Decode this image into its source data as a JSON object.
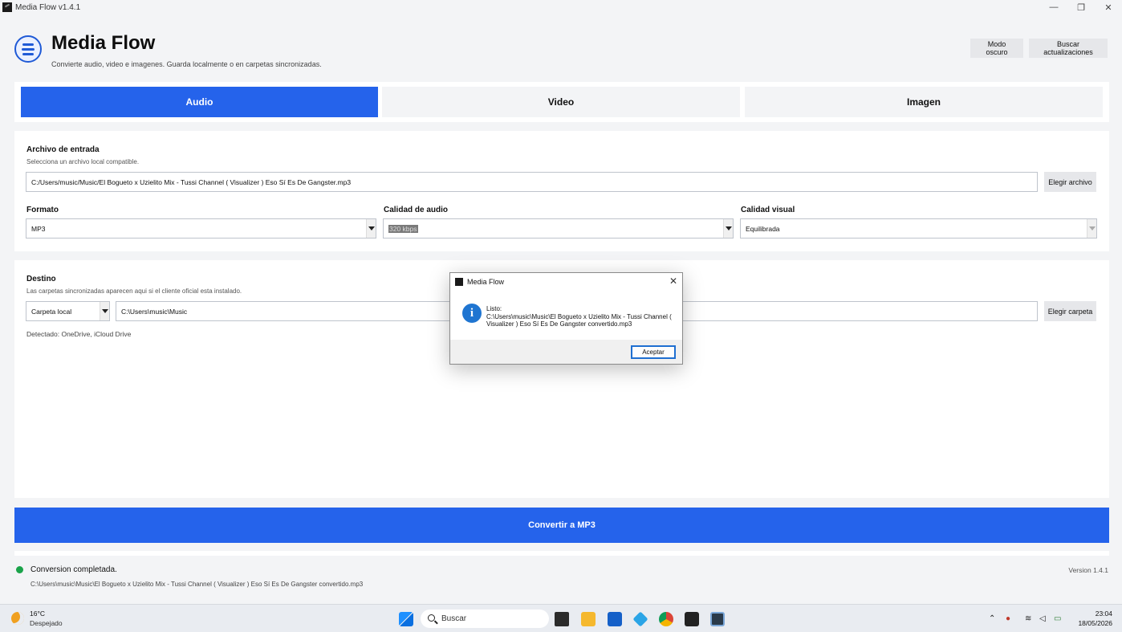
{
  "window": {
    "title": "Media Flow v1.4.1",
    "controls": {
      "minimize": "—",
      "maximize": "❐",
      "close": "✕"
    }
  },
  "header": {
    "title": "Media Flow",
    "subtitle": "Convierte audio, video e imagenes. Guarda localmente o en carpetas sincronizadas.",
    "dark_mode_label": "Modo oscuro",
    "check_updates_label": "Buscar actualizaciones"
  },
  "tabs": [
    {
      "label": "Audio",
      "active": true
    },
    {
      "label": "Video",
      "active": false
    },
    {
      "label": "Imagen",
      "active": false
    }
  ],
  "input": {
    "label": "Archivo de entrada",
    "hint": "Selecciona un archivo local compatible.",
    "path": "C:/Users/music/Music/El Bogueto x Uzielito Mix - Tussi Channel ( Visualizer ) Eso Sí  Es De Gangster.mp3",
    "choose_label": "Elegir archivo"
  },
  "options": {
    "format_label": "Formato",
    "format_value": "MP3",
    "audio_quality_label": "Calidad de audio",
    "audio_quality_value": "320 kbps",
    "visual_quality_label": "Calidad visual",
    "visual_quality_value": "Equilibrada"
  },
  "destination": {
    "label": "Destino",
    "hint": "Las carpetas sincronizadas aparecen aqui si el cliente oficial esta instalado.",
    "type_value": "Carpeta local",
    "path": "C:\\Users\\music\\Music",
    "choose_label": "Elegir carpeta",
    "detected": "Detectado: OneDrive, iCloud Drive"
  },
  "convert_label": "Convertir a MP3",
  "status": {
    "text": "Conversion completada.",
    "path": "C:\\Users\\music\\Music\\El Bogueto x Uzielito Mix - Tussi Channel ( Visualizer ) Eso Sí  Es De Gangster convertido.mp3",
    "version": "Version 1.4.1",
    "color": "#1aa34a"
  },
  "dialog": {
    "title": "Media Flow",
    "message_line1": "Listo:",
    "message_line2": "C:\\Users\\music\\Music\\El Bogueto x Uzielito Mix - Tussi Channel ( Visualizer ) Eso Sí  Es De Gangster convertido.mp3",
    "ok_label": "Aceptar",
    "icon": "info-icon"
  },
  "taskbar": {
    "weather_temp": "16°C",
    "weather_desc": "Despejado",
    "search_placeholder": "Buscar",
    "time": "23:04",
    "date": "18/05/2026"
  },
  "colors": {
    "accent": "#2563eb"
  }
}
